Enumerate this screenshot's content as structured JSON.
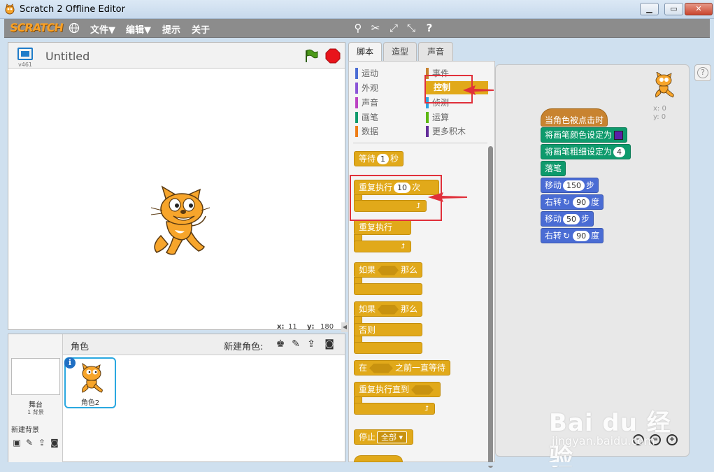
{
  "window": {
    "title": "Scratch 2 Offline Editor",
    "minimize_icon": "minimize-icon",
    "maximize_icon": "maximize-icon",
    "close_icon": "close-icon"
  },
  "menubar": {
    "logo": "SCRATCH",
    "language_icon": "globe-icon",
    "items": [
      {
        "label": "文件▼"
      },
      {
        "label": "编辑▼"
      },
      {
        "label": "提示"
      },
      {
        "label": "关于"
      }
    ],
    "tools": [
      "duplicate-icon",
      "delete-icon",
      "grow-icon",
      "shrink-icon",
      "help-icon"
    ],
    "tool_glyphs": [
      "⚲",
      "✂",
      "⤢",
      "⤡",
      "?"
    ]
  },
  "stage": {
    "version": "v461",
    "project_title": "Untitled",
    "coords": {
      "x_label": "x:",
      "x": "11",
      "y_label": "y:",
      "y": "180"
    }
  },
  "sprites_panel": {
    "label": "角色",
    "new_sprite_label": "新建角色:",
    "stage_name": "舞台",
    "backdrop_count": "1 背景",
    "new_backdrop_label": "新建背景",
    "sprite": {
      "name": "角色2",
      "info": "i"
    }
  },
  "tabs": [
    {
      "label": "脚本",
      "active": true
    },
    {
      "label": "造型",
      "active": false
    },
    {
      "label": "声音",
      "active": false
    }
  ],
  "categories": {
    "left": [
      {
        "label": "运动",
        "color": "#4a6cd4"
      },
      {
        "label": "外观",
        "color": "#8a55d7"
      },
      {
        "label": "声音",
        "color": "#bb42c3"
      },
      {
        "label": "画笔",
        "color": "#0e9a6c"
      },
      {
        "label": "数据",
        "color": "#ee7d16"
      }
    ],
    "right": [
      {
        "label": "事件",
        "color": "#c88330"
      },
      {
        "label": "控制",
        "color": "#e1a91a"
      },
      {
        "label": "侦测",
        "color": "#2ca5e2"
      },
      {
        "label": "运算",
        "color": "#5cb712"
      },
      {
        "label": "更多积木",
        "color": "#632d99"
      }
    ],
    "selected": "控制"
  },
  "palette": {
    "wait": {
      "a": "等待",
      "val": "1",
      "b": "秒"
    },
    "repeat": {
      "a": "重复执行",
      "val": "10",
      "b": "次"
    },
    "forever": {
      "a": "重复执行"
    },
    "if_then": {
      "a": "如果",
      "b": "那么"
    },
    "if_else": {
      "a": "如果",
      "b": "那么",
      "c": "否则"
    },
    "wait_until": {
      "a": "在",
      "b": "之前一直等待"
    },
    "repeat_until": {
      "a": "重复执行直到"
    },
    "stop": {
      "a": "停止",
      "val": "全部"
    }
  },
  "script": {
    "sprite_x": "x: 0",
    "sprite_y": "y: 0",
    "blocks": [
      {
        "type": "event",
        "text": "当角色被点击时"
      },
      {
        "type": "pen",
        "text": "将画笔颜色设定为"
      },
      {
        "type": "pen",
        "text": "将画笔粗细设定为",
        "val": "4"
      },
      {
        "type": "pen",
        "text": "落笔"
      },
      {
        "type": "motion",
        "text": "移动",
        "val": "150",
        "suffix": "步"
      },
      {
        "type": "motion",
        "text": "右转",
        "val": "90",
        "suffix": "度"
      },
      {
        "type": "motion",
        "text": "移动",
        "val": "50",
        "suffix": "步"
      },
      {
        "type": "motion",
        "text": "右转",
        "val": "90",
        "suffix": "度"
      }
    ],
    "pen_color": "#5b1fa8"
  },
  "watermark": {
    "brand": "Bai du 经验",
    "url": "jingyan.baidu.com"
  },
  "colors": {
    "control": "#e1a91a",
    "events": "#c88330",
    "pen": "#0e9a6c",
    "motion": "#4a6cd4",
    "annotation_red": "#e0303a",
    "menubar": "#8c8c8c"
  }
}
